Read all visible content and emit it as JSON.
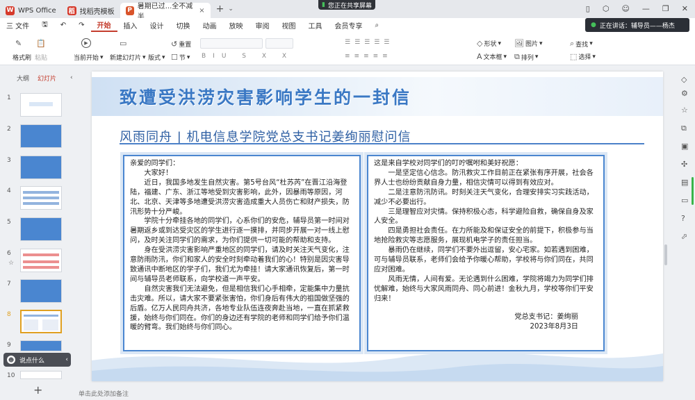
{
  "tabs": [
    {
      "label": "WPS Office",
      "icon": "W",
      "color": "#d63a2c"
    },
    {
      "label": "找稻壳模板",
      "icon": "稻",
      "color": "#d63a2c"
    },
    {
      "label": "暑期已过...全不减半",
      "icon": "P",
      "color": "#d9542b"
    }
  ],
  "share_label": "您正在共享屏幕",
  "speaking_label": "正在讲话：辅导员——杨杰",
  "menu": [
    "三 文件",
    "开始",
    "插入",
    "设计",
    "切换",
    "动画",
    "放映",
    "审阅",
    "视图",
    "工具",
    "会员专享"
  ],
  "ribbon": {
    "format_painter": "格式刷",
    "paste": "粘贴",
    "play_from": "当前开始",
    "new_slide": "新建幻灯片",
    "layout": "版式",
    "section": "节",
    "reset": "重置",
    "shape": "形状",
    "picture": "图片",
    "textbox": "文本框",
    "arrange": "排列",
    "find": "查找",
    "select": "选择"
  },
  "left_panel": {
    "outline": "大纲",
    "slides": "幻灯片",
    "chat_placeholder": "说点什么",
    "slide_numbers": [
      "1",
      "2",
      "3",
      "4",
      "5",
      "6",
      "7",
      "8",
      "9",
      "10"
    ]
  },
  "slide": {
    "title": "致遭受洪涝灾害影响学生的一封信",
    "subtitle": "风雨同舟 | 机电信息学院党总支书记姜绚丽慰问信",
    "left_paras": [
      "亲爱的同学们：",
      "大家好！",
      "近日，我国多地发生自然灾害。第5号台风“杜苏芮”在晋江沿海登陆，福建、广东、浙江等地受到灾害影响，此外，因暴雨等原因，河北、北京、天津等多地遭受洪涝灾害造成重大人员伤亡和财产损失，防汛形势十分严峻。",
      "学院十分牵挂各地的同学们，心系你们的安危，辅导员第一时间对暑期返乡或到达受灾区的学生进行逐一摸排，并同步开展一对一线上慰问，及时关注同学们的需求，为你们提供一切可能的帮助和支持。",
      "身在受洪涝灾害影响严重地区的同学们，请及时关注天气变化，注意防雨防汛，你们和家人的安全时刻牵动着我们的心！特别是因灾害导致通讯中断地区的学子们，我们尤为牵挂！请大家通讯恢复后，第一时间与辅导员老师联系，向学校道一声平安。",
      "自然灾害我们无法避免，但是相信我们心手相牵，定能集中力量抗击灾难。所以，请大家不要紧张害怕，你们身后有伟大的祖国做坚强的后盾。亿万人民同舟共济，各地专业队伍连夜奔赴当地，一直在抓紧救援，始终与你们同在。你们的身边还有学院的老师和同学们给予你们温暖的臂弯。我们始终与你们同心。"
    ],
    "right_paras": [
      "这是来自学校对同学们的叮咛嘱咐和美好祝愿：",
      "一是坚定信心信念。防汛救灾工作目前正在紧张有序开展，社会各界人士也纷纷贡献自身力量，相信灾情可以得到有效应对。",
      "二是注意防汛防讯。时刻关注天气变化，合理安排实习实践活动，减少不必要出行。",
      "三是理智应对灾情。保持积极心态，科学避险自救，确保自身及家人安全。",
      "四是勇担社会责任。在力所能及和保证安全的前提下，积极参与当地抢险救灾等志愿服务，展现机电学子的责任担当。",
      "暴雨仍在继续，同学们不要外出逗留，安心宅家。如若遇到困难，可与辅导员联系，老师们会给予你暖心帮助，学校将与你们同在，共同应对困难。",
      "风雨无情，人间有爱。无论遇到什么困难，学院将竭力为同学们排忧解难，始终与大家风雨同舟、同心前进！金秋九月，学校等你们平安归来！"
    ],
    "signature": "党总支书记：姜绚丽",
    "date": "2023年8月3日"
  },
  "notes_placeholder": "单击此处添加备注"
}
